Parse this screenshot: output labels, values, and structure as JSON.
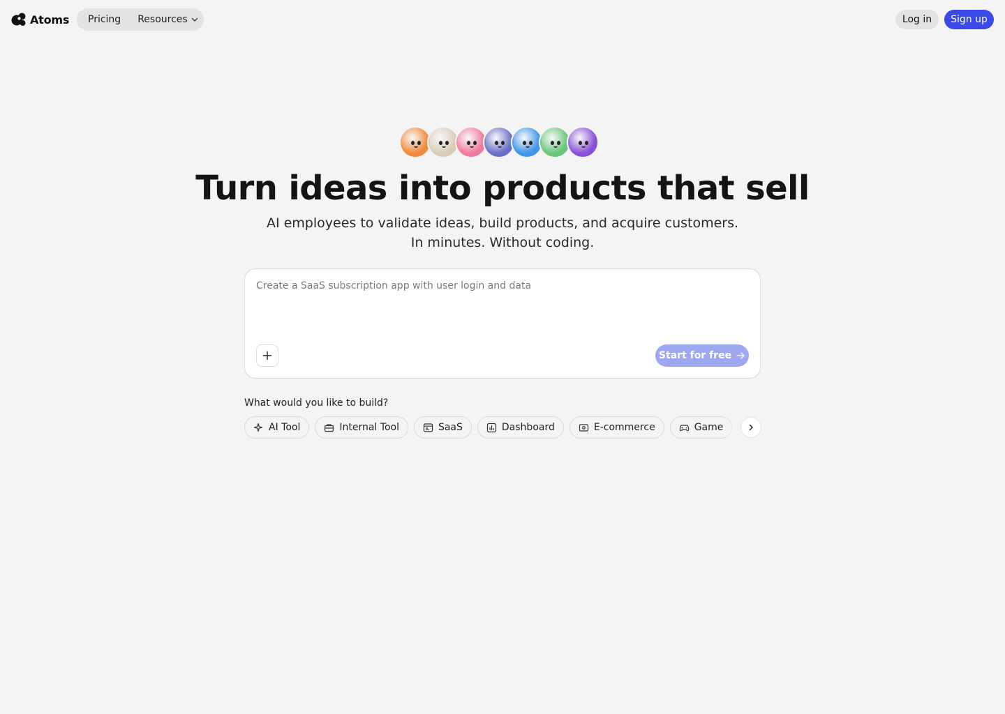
{
  "header": {
    "brand_name": "Atoms",
    "nav": {
      "pricing_label": "Pricing",
      "resources_label": "Resources"
    },
    "login_label": "Log in",
    "signup_label": "Sign up"
  },
  "hero": {
    "avatars": [
      {
        "name": "orange-character-avatar",
        "color": "#f08a3c"
      },
      {
        "name": "beige-character-avatar",
        "color": "#d9cdb8"
      },
      {
        "name": "pink-character-avatar",
        "color": "#f07a9c"
      },
      {
        "name": "indigo-character-avatar",
        "color": "#6a70c8"
      },
      {
        "name": "blue-character-avatar",
        "color": "#3f96e8"
      },
      {
        "name": "green-character-avatar",
        "color": "#6cc67a"
      },
      {
        "name": "purple-character-avatar",
        "color": "#8a4fd8"
      }
    ],
    "title": "Turn ideas into products that sell",
    "subtitle_line1": "AI employees to validate ideas, build products, and acquire customers.",
    "subtitle_line2": "In minutes. Without coding."
  },
  "prompt": {
    "placeholder": "Create a SaaS subscription app with user login and data",
    "start_label": "Start for free"
  },
  "suggestions": {
    "label": "What would you like to build?",
    "chips": [
      {
        "label": "AI Tool",
        "icon": "sparkles-icon"
      },
      {
        "label": "Internal Tool",
        "icon": "toolbox-icon"
      },
      {
        "label": "SaaS",
        "icon": "browser-window-icon"
      },
      {
        "label": "Dashboard",
        "icon": "chart-icon"
      },
      {
        "label": "E-commerce",
        "icon": "cash-icon"
      },
      {
        "label": "Game",
        "icon": "gamepad-icon"
      },
      {
        "label": "",
        "icon": "laptop-icon"
      }
    ]
  },
  "colors": {
    "background": "#f4f4f4",
    "brand_blue": "#3b49e6",
    "start_button_disabled": "#9ea8f0"
  }
}
